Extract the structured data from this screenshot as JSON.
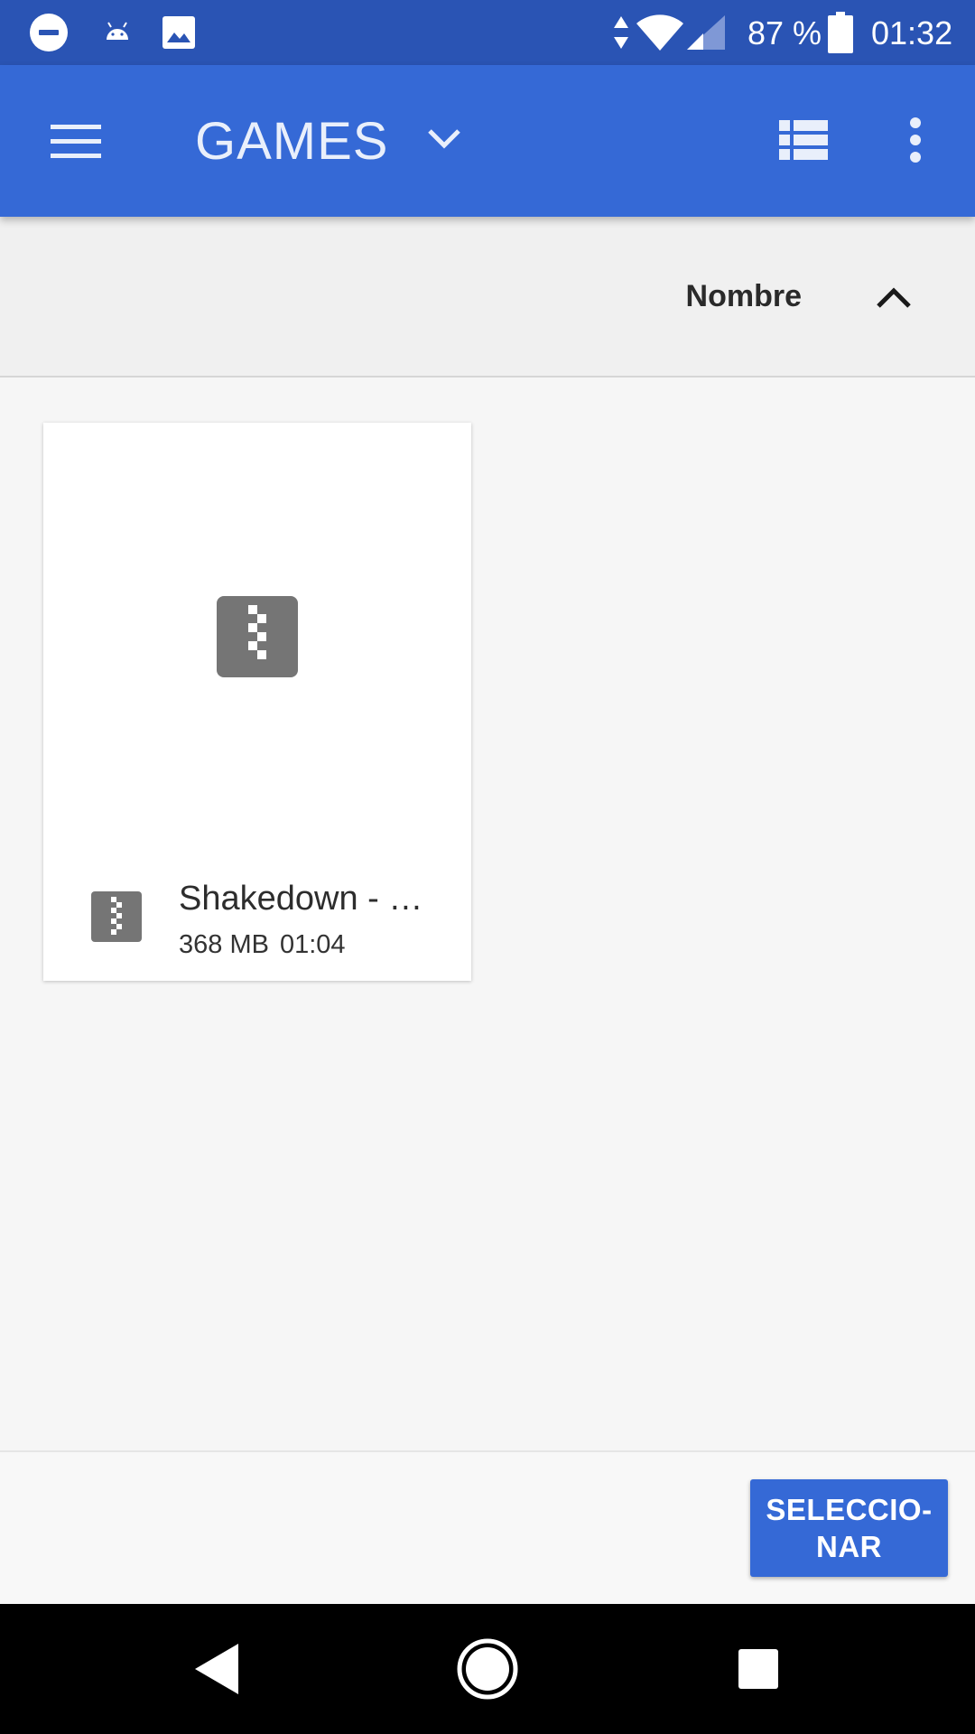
{
  "status_bar": {
    "battery_percent": "87 %",
    "battery_level": 0.87,
    "time": "01:32",
    "icons": [
      "dnd-icon",
      "android-icon",
      "image-icon",
      "data-transfer-icon",
      "wifi-icon",
      "signal-icon",
      "battery-icon"
    ]
  },
  "app_bar": {
    "title": "GAMES",
    "icons": [
      "menu-icon",
      "chevron-down-icon",
      "list-view-icon",
      "more-vert-icon"
    ]
  },
  "sort": {
    "label": "Nombre",
    "direction": "ascending",
    "icon": "chevron-up-icon"
  },
  "files": [
    {
      "name": "Shakedown - …",
      "size": "368 MB",
      "time": "01:04",
      "icon": "zip-archive-icon"
    }
  ],
  "actions": {
    "select_label": "SELECCIO-\nNAR"
  },
  "nav_bar": {
    "icons": [
      "back-icon",
      "home-icon",
      "recents-icon"
    ]
  },
  "colors": {
    "status_bar": "#2a54b4",
    "app_bar": "#3569d6",
    "accent": "#3569d6",
    "background": "#f6f6f6",
    "sort_bar": "#f0f0f0",
    "zip_icon": "#757575"
  }
}
